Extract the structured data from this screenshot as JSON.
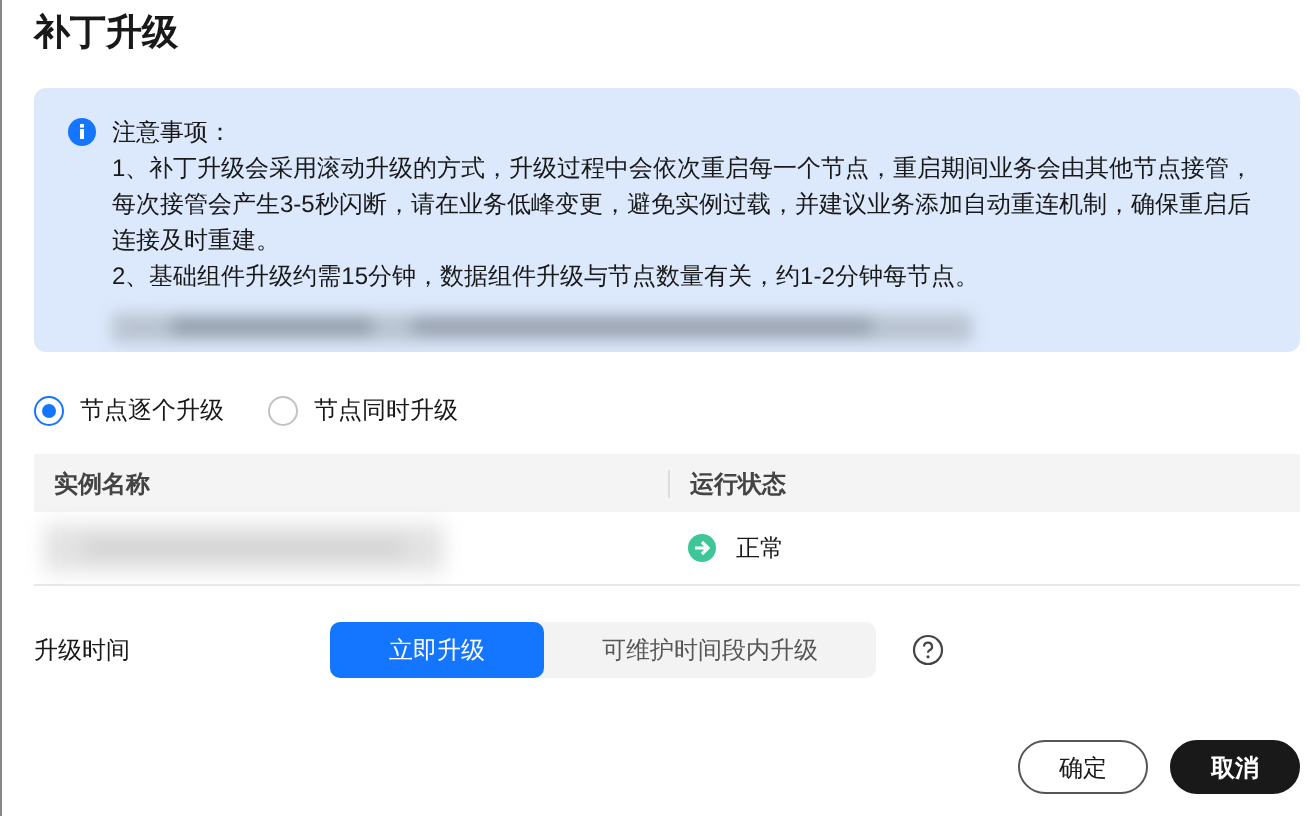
{
  "title": "补丁升级",
  "notice": {
    "heading": "注意事项：",
    "items": [
      "1、补丁升级会采用滚动升级的方式，升级过程中会依次重启每一个节点，重启期间业务会由其他节点接管，每次接管会产生3-5秒闪断，请在业务低峰变更，避免实例过载，并建议业务添加自动重连机制，确保重启后连接及时重建。",
      "2、基础组件升级约需15分钟，数据组件升级与节点数量有关，约1-2分钟每节点。"
    ]
  },
  "upgrade_mode": [
    {
      "label": "节点逐个升级",
      "selected": true
    },
    {
      "label": "节点同时升级",
      "selected": false
    }
  ],
  "table": {
    "columns": [
      "实例名称",
      "运行状态"
    ],
    "rows": [
      {
        "status": "正常"
      }
    ]
  },
  "upgrade_time": {
    "label": "升级时间",
    "options": [
      {
        "label": "立即升级",
        "selected": true
      },
      {
        "label": "可维护时间段内升级",
        "selected": false
      }
    ]
  },
  "buttons": [
    {
      "label": "确定",
      "kind": "secondary"
    },
    {
      "label": "取消",
      "kind": "primary"
    }
  ]
}
